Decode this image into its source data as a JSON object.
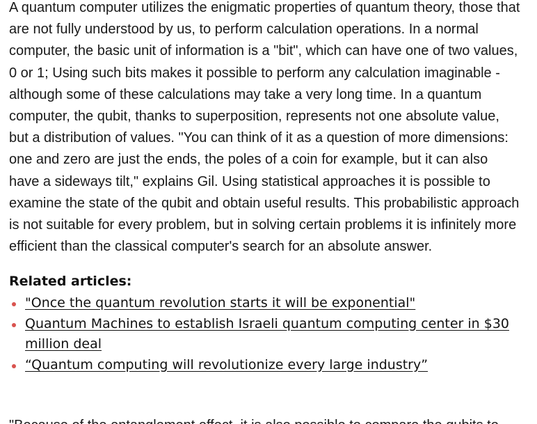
{
  "article": {
    "paragraph_lines": [
      "A quantum computer utilizes the enigmatic properties of quantum theory, those that",
      "are not fully understood by us, to perform calculation operations. In a normal",
      "computer, the basic unit of information is a \"bit\", which can have one of two values,",
      "0 or 1; Using such bits makes it possible to perform any calculation imaginable -",
      "although some of these calculations may take a very long time. In a quantum",
      "computer, the qubit, thanks to superposition, represents not one absolute value,",
      "but a distribution of values. \"You can think of it as a question of more dimensions:",
      "one and zero are just the ends, the poles of a coin for example, but it can also",
      "have a sideways tilt,\" explains Gil. Using statistical approaches it is possible to",
      "examine the state of the qubit and obtain useful results. This probabilistic approach",
      "is not suitable for every problem, but in solving certain problems it is infinitely more",
      "efficient than the classical computer's search for an absolute answer."
    ],
    "next_paragraph_partial": "\"Because of the entanglement effect, it is also possible to compare the qubits to"
  },
  "related": {
    "heading": "Related articles:",
    "items": [
      {
        "lines": [
          "\"Once the quantum revolution starts it will be exponential\""
        ]
      },
      {
        "lines": [
          "Quantum Machines to establish Israeli quantum computing center in $30 ",
          "million deal"
        ]
      },
      {
        "lines": [
          "“Quantum computing will revolutionize every large industry”"
        ]
      }
    ]
  },
  "colors": {
    "bullet": "#d9534f",
    "text": "#1a1a1a"
  }
}
